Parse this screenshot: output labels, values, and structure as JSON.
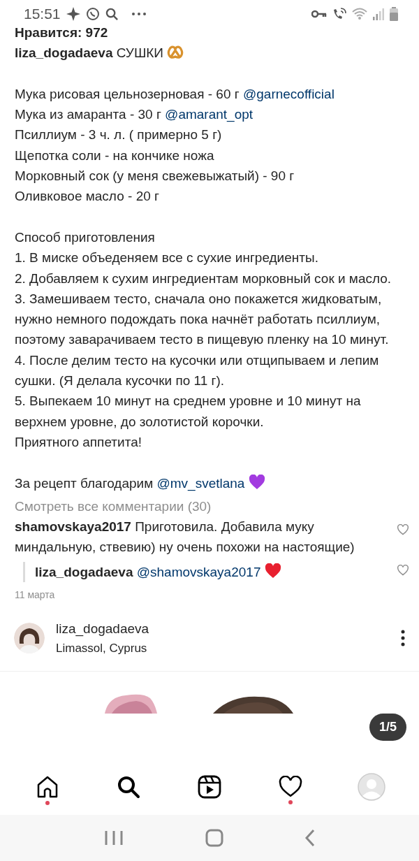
{
  "status_bar": {
    "time": "15:51"
  },
  "likes": "Нравится: 972",
  "caption": {
    "author": "liza_dogadaeva",
    "title": "СУШКИ",
    "ingredients": [
      {
        "text": "Мука рисовая цельнозерновая - 60 г ",
        "mention": "@garnecofficial"
      },
      {
        "text": "Мука из амаранта - 30 г ",
        "mention": "@amarant_opt"
      },
      {
        "text": "Псиллиум - 3 ч. л. ( примерно 5 г)"
      },
      {
        "text": "Щепотка соли - на кончике ножа"
      },
      {
        "text": "Морковный сок (у меня свежевыжатый) - 90 г"
      },
      {
        "text": "Оливковое масло - 20 г"
      }
    ],
    "method_title": "Способ приготовления",
    "steps": [
      "1. В миске объеденяем все с сухие ингредиенты.",
      "2. Добавляем к сухим ингредиентам морковный сок и масло.",
      "3. Замешиваем тесто, сначала оно покажется жидковатым, нужно немного подождать пока начнёт работать псиллиум, поэтому заварачиваем тесто в пищевую пленку на 10 минут.",
      "4. После делим тесто на кусочки или отщипываем и лепим сушки. (Я делала кусочки по 11 г).",
      "5. Выпекаем 10 минут на среднем уровне и 10 минут на верхнем уровне, до золотистой корочки.",
      "Приятного аппетита!"
    ],
    "thanks": {
      "text": "За рецепт благодарим ",
      "mention": "@mv_svetlana"
    }
  },
  "view_all": "Смотреть все комментарии (30)",
  "comments": [
    {
      "author": "shamovskaya2017",
      "text": "Приготовила. Добавила муку миндальную, ствевию) ну очень похожи на настоящие)",
      "reply": false,
      "liked": false
    },
    {
      "author": "liza_dogadaeva",
      "mention": "@shamovskaya2017",
      "reply": true,
      "liked": false
    }
  ],
  "date": "11 марта",
  "next_post": {
    "author": "liza_dogadaeva",
    "location": "Limassol, Cyprus",
    "counter": "1/5"
  },
  "nav": [
    {
      "kind": "home",
      "selected": false,
      "dot": true
    },
    {
      "kind": "search",
      "selected": true,
      "dot": false
    },
    {
      "kind": "reels",
      "selected": false,
      "dot": false
    },
    {
      "kind": "heart",
      "selected": false,
      "dot": true
    },
    {
      "kind": "profile",
      "selected": false,
      "dot": false
    }
  ]
}
